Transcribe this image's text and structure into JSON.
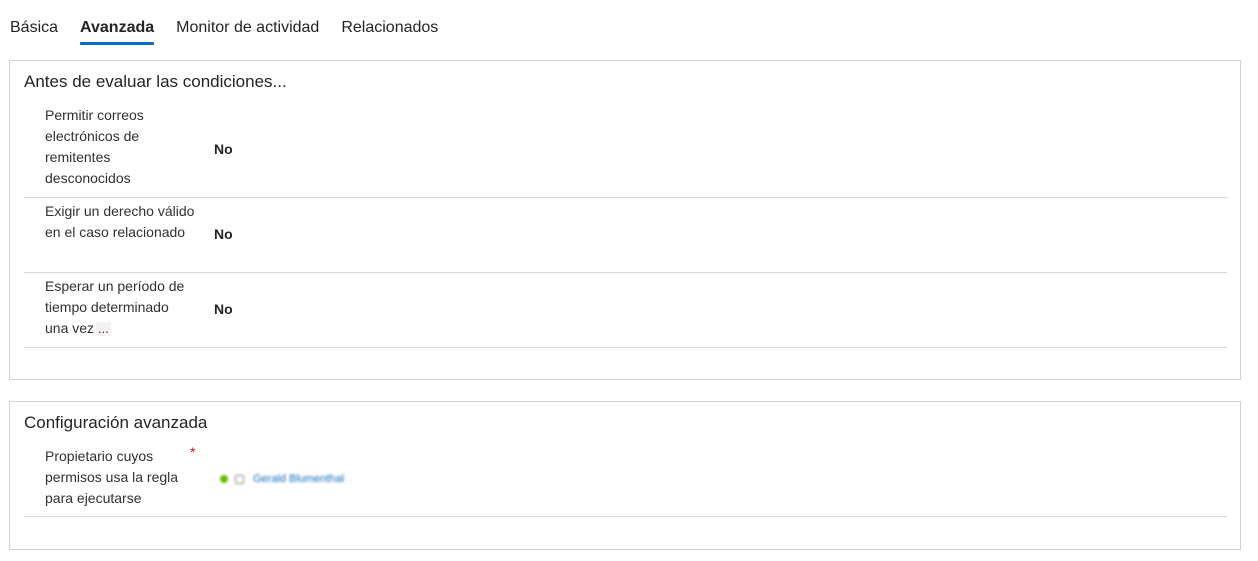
{
  "tabs": [
    {
      "label": "Básica",
      "active": false
    },
    {
      "label": "Avanzada",
      "active": true
    },
    {
      "label": "Monitor de actividad",
      "active": false
    },
    {
      "label": "Relacionados",
      "active": false
    }
  ],
  "section_conditions": {
    "title": "Antes de evaluar las condiciones...",
    "fields": [
      {
        "label": "Permitir correos electrónicos de remitentes desconocidos",
        "value": "No"
      },
      {
        "label": "Exigir un derecho válido en el caso relacionado",
        "value": "No"
      },
      {
        "label": "Esperar un período de tiempo determinado una vez",
        "value": "No",
        "more": "..."
      }
    ]
  },
  "section_advanced": {
    "title": "Configuración avanzada",
    "owner_field": {
      "label": "Propietario cuyos permisos usa la regla para ejecutarse",
      "required_mark": "*",
      "value": "Gerald Blumenthal"
    }
  },
  "colors": {
    "accent": "#0f6cbd",
    "required": "#c50f1f",
    "presence": "#6bb700",
    "border": "#d1d1d1"
  },
  "icons": {
    "presence": "presence-available-icon",
    "user": "user-icon"
  }
}
